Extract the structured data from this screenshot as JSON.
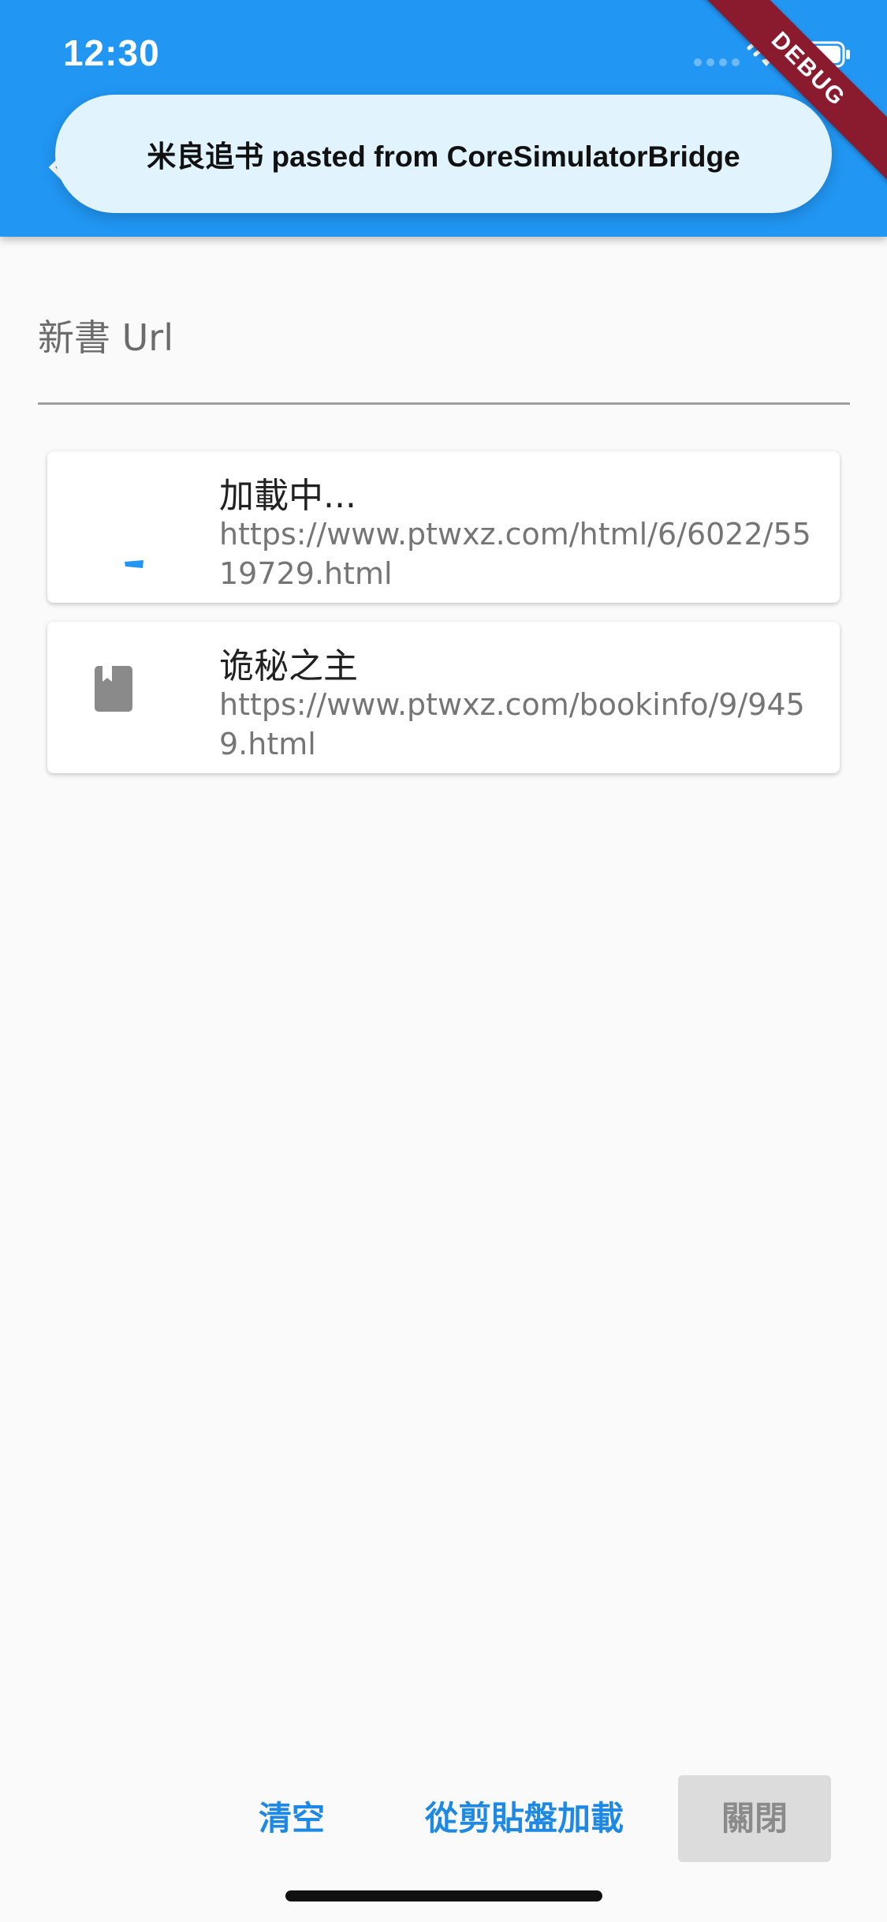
{
  "status_bar": {
    "time": "12:30",
    "icons": [
      "signal-icon",
      "wifi-icon",
      "battery-icon"
    ]
  },
  "app_bar": {
    "color": "#2196f3",
    "back_icon": "back-icon"
  },
  "banner": {
    "text": "米良追书 pasted from CoreSimulatorBridge"
  },
  "debug_ribbon": {
    "text": "DEBUG"
  },
  "url_field": {
    "placeholder": "新書 Url"
  },
  "books": [
    {
      "title": "加載中...",
      "url": "https://www.ptwxz.com/html/6/6022/5519729.html",
      "icon": "loading-spinner-icon"
    },
    {
      "title": "诡秘之主",
      "url": "https://www.ptwxz.com/bookinfo/9/9459.html",
      "icon": "book-icon"
    }
  ],
  "actions": {
    "clear": "清空",
    "paste_load": "從剪貼盤加載",
    "close": "關閉"
  },
  "colors": {
    "accent": "#1e88e5",
    "banner_bg": "#e1f4fd",
    "ribbon": "#8a1b2e"
  }
}
